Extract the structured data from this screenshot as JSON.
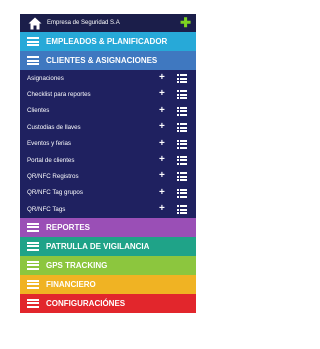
{
  "header": {
    "title": "Empresa de Seguridad S.A"
  },
  "sections_top": [
    {
      "label": "EMPLEADOS & PLANIFICADOR",
      "color": "#27a9d8"
    },
    {
      "label": "CLIENTES & ASIGNACIONES",
      "color": "#3f78c0"
    }
  ],
  "client_items": [
    {
      "label": "Asignaciones"
    },
    {
      "label": "Checklist para reportes"
    },
    {
      "label": "Clientes"
    },
    {
      "label": "Custodias de llaves"
    },
    {
      "label": "Eventos y ferias"
    },
    {
      "label": "Portal de clientes"
    },
    {
      "label": "QR/NFC Registros"
    },
    {
      "label": "QR/NFC Tag grupos"
    },
    {
      "label": "QR/NFC Tags"
    }
  ],
  "sections_bottom": [
    {
      "label": "REPORTES",
      "color": "#9a4fb6"
    },
    {
      "label": "PATRULLA DE VIGILANCIA",
      "color": "#1fa388"
    },
    {
      "label": "GPS TRACKING",
      "color": "#8cc63e"
    },
    {
      "label": "FINANCIERO",
      "color": "#f0b323"
    },
    {
      "label": "CONFIGURACIÓNES",
      "color": "#e2262c"
    }
  ],
  "colors": {
    "topbar": "#1b1e4a",
    "items_bg": "#1f2160",
    "add_icon": "#7ed321"
  },
  "icons": {
    "home": "home-icon",
    "add": "plus-icon",
    "menu": "hamburger-icon",
    "list": "list-icon"
  }
}
